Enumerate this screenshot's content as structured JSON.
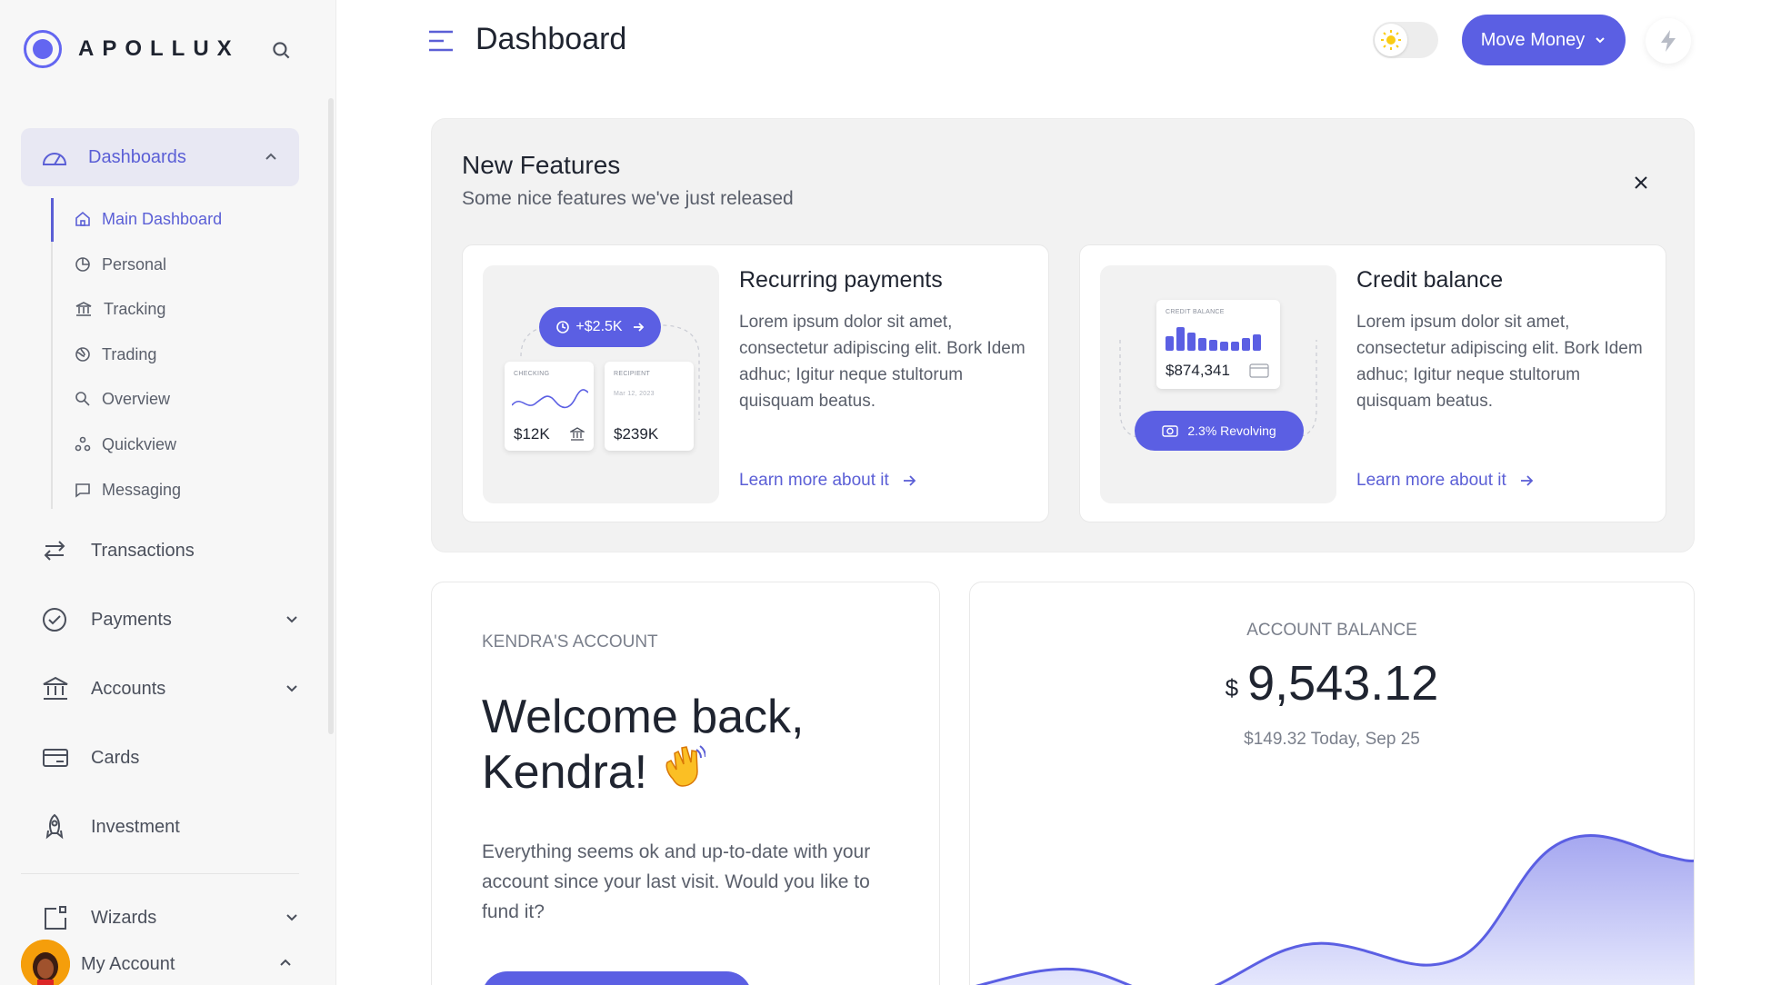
{
  "brand": {
    "name": "APOLLUX"
  },
  "sidebar": {
    "dashboards_label": "Dashboards",
    "subitems": [
      {
        "label": "Main Dashboard",
        "icon": "home-icon",
        "active": true
      },
      {
        "label": "Personal",
        "icon": "pie-icon"
      },
      {
        "label": "Tracking",
        "icon": "bank-icon"
      },
      {
        "label": "Trading",
        "icon": "globe-icon"
      },
      {
        "label": "Overview",
        "icon": "tag-icon"
      },
      {
        "label": "Quickview",
        "icon": "nodes-icon"
      },
      {
        "label": "Messaging",
        "icon": "message-icon"
      }
    ],
    "nav": [
      {
        "label": "Transactions",
        "icon": "arrows-icon"
      },
      {
        "label": "Payments",
        "icon": "check-circle-icon"
      },
      {
        "label": "Accounts",
        "icon": "bank-icon"
      },
      {
        "label": "Cards",
        "icon": "card-icon"
      },
      {
        "label": "Investment",
        "icon": "rocket-icon"
      },
      {
        "label": "Wizards",
        "icon": "wizard-icon"
      }
    ],
    "my_account": "My Account"
  },
  "header": {
    "title": "Dashboard",
    "move_money": "Move Money"
  },
  "features": {
    "title": "New Features",
    "subtitle": "Some nice features we've just released",
    "cards": [
      {
        "title": "Recurring payments",
        "desc": "Lorem ipsum dolor sit amet, consectetur adipiscing elit. Bork Idem adhuc; Igitur neque stultorum quisquam beatus.",
        "link": "Learn more about it",
        "illus": {
          "pill": "+$2.5K",
          "checking_label": "CHECKING",
          "checking_value": "$12K",
          "recipient_label": "RECIPIENT",
          "recipient_date": "Mar 12, 2023",
          "recipient_value": "$239K"
        }
      },
      {
        "title": "Credit balance",
        "desc": "Lorem ipsum dolor sit amet, consectetur adipiscing elit. Bork Idem adhuc; Igitur neque stultorum quisquam beatus.",
        "link": "Learn more about it",
        "illus": {
          "label": "CREDIT BALANCE",
          "value": "$874,341",
          "pill": "2.3% Revolving"
        }
      }
    ]
  },
  "account": {
    "label": "KENDRA'S ACCOUNT",
    "welcome_line1": "Welcome back,",
    "welcome_line2": "Kendra!",
    "text": "Everything seems ok and up-to-date with your account since your last visit. Would you like to fund it?"
  },
  "balance": {
    "label": "ACCOUNT BALANCE",
    "currency": "$",
    "amount": "9,543.12",
    "sub": "$149.32 Today, Sep 25"
  },
  "colors": {
    "accent": "#5b5fe3",
    "chart_fill": "#c7c8f5"
  }
}
